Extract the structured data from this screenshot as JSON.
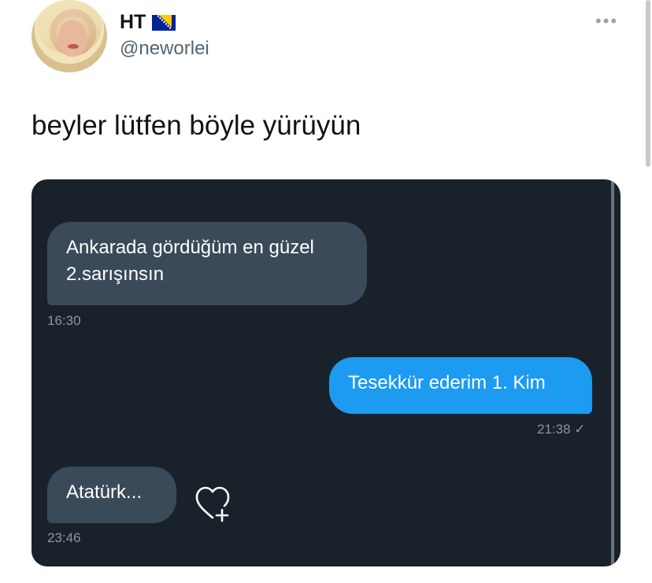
{
  "user": {
    "display_name": "HT",
    "handle": "@neworlei"
  },
  "tweet": {
    "text": "beyler lütfen böyle yürüyün"
  },
  "chat": {
    "messages": [
      {
        "direction": "incoming",
        "text_line1": "Ankarada gördüğüm en güzel",
        "text_line2": "2.sarışınsın",
        "time": "16:30"
      },
      {
        "direction": "outgoing",
        "text": "Tesekkür ederim 1. Kim",
        "time": "21:38 ✓"
      },
      {
        "direction": "incoming",
        "text": "Atatürk...",
        "time": "23:46"
      }
    ]
  },
  "icons": {
    "more": "more-horizontal-icon",
    "flag": "bosnia-flag-icon",
    "react": "heart-plus-icon"
  },
  "colors": {
    "outgoing_bubble": "#1d9bf0",
    "incoming_bubble": "#3a4a59",
    "chat_background": "#19212a"
  }
}
